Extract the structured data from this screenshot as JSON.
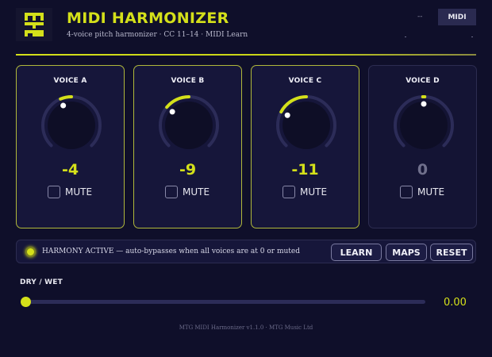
{
  "header": {
    "logo_text": "MTG",
    "title": "MIDI HARMONIZER",
    "subtitle": "4-voice pitch harmonizer · CC 11–14 · MIDI Learn",
    "midi_status": "--",
    "midi_label": "MIDI"
  },
  "colors": {
    "accent": "#d4e01a",
    "background": "#0f0f2a",
    "panel": "#16163a",
    "knob_track": "#2c2c58",
    "inactive_text": "#70708c"
  },
  "voices": [
    {
      "label": "VOICE A",
      "value": "-4",
      "semitones": -4,
      "mute_label": "MUTE",
      "muted": false,
      "active": true
    },
    {
      "label": "VOICE B",
      "value": "-9",
      "semitones": -9,
      "mute_label": "MUTE",
      "muted": false,
      "active": true
    },
    {
      "label": "VOICE C",
      "value": "-11",
      "semitones": -11,
      "mute_label": "MUTE",
      "muted": false,
      "active": true
    },
    {
      "label": "VOICE D",
      "value": "0",
      "semitones": 0,
      "mute_label": "MUTE",
      "muted": false,
      "active": false
    }
  ],
  "knob_range": {
    "min": -24,
    "max": 24
  },
  "status": {
    "text": "HARMONY ACTIVE — auto-bypasses when all voices are at 0 or muted",
    "active": true
  },
  "buttons": {
    "learn": "LEARN",
    "maps": "MAPS",
    "reset": "RESET"
  },
  "drywet": {
    "label": "DRY / WET",
    "value_text": "0.00",
    "value": 0.0
  },
  "footer": {
    "text": "MTG MIDI Harmonizer v1.1.0 · MTG Music Ltd"
  }
}
